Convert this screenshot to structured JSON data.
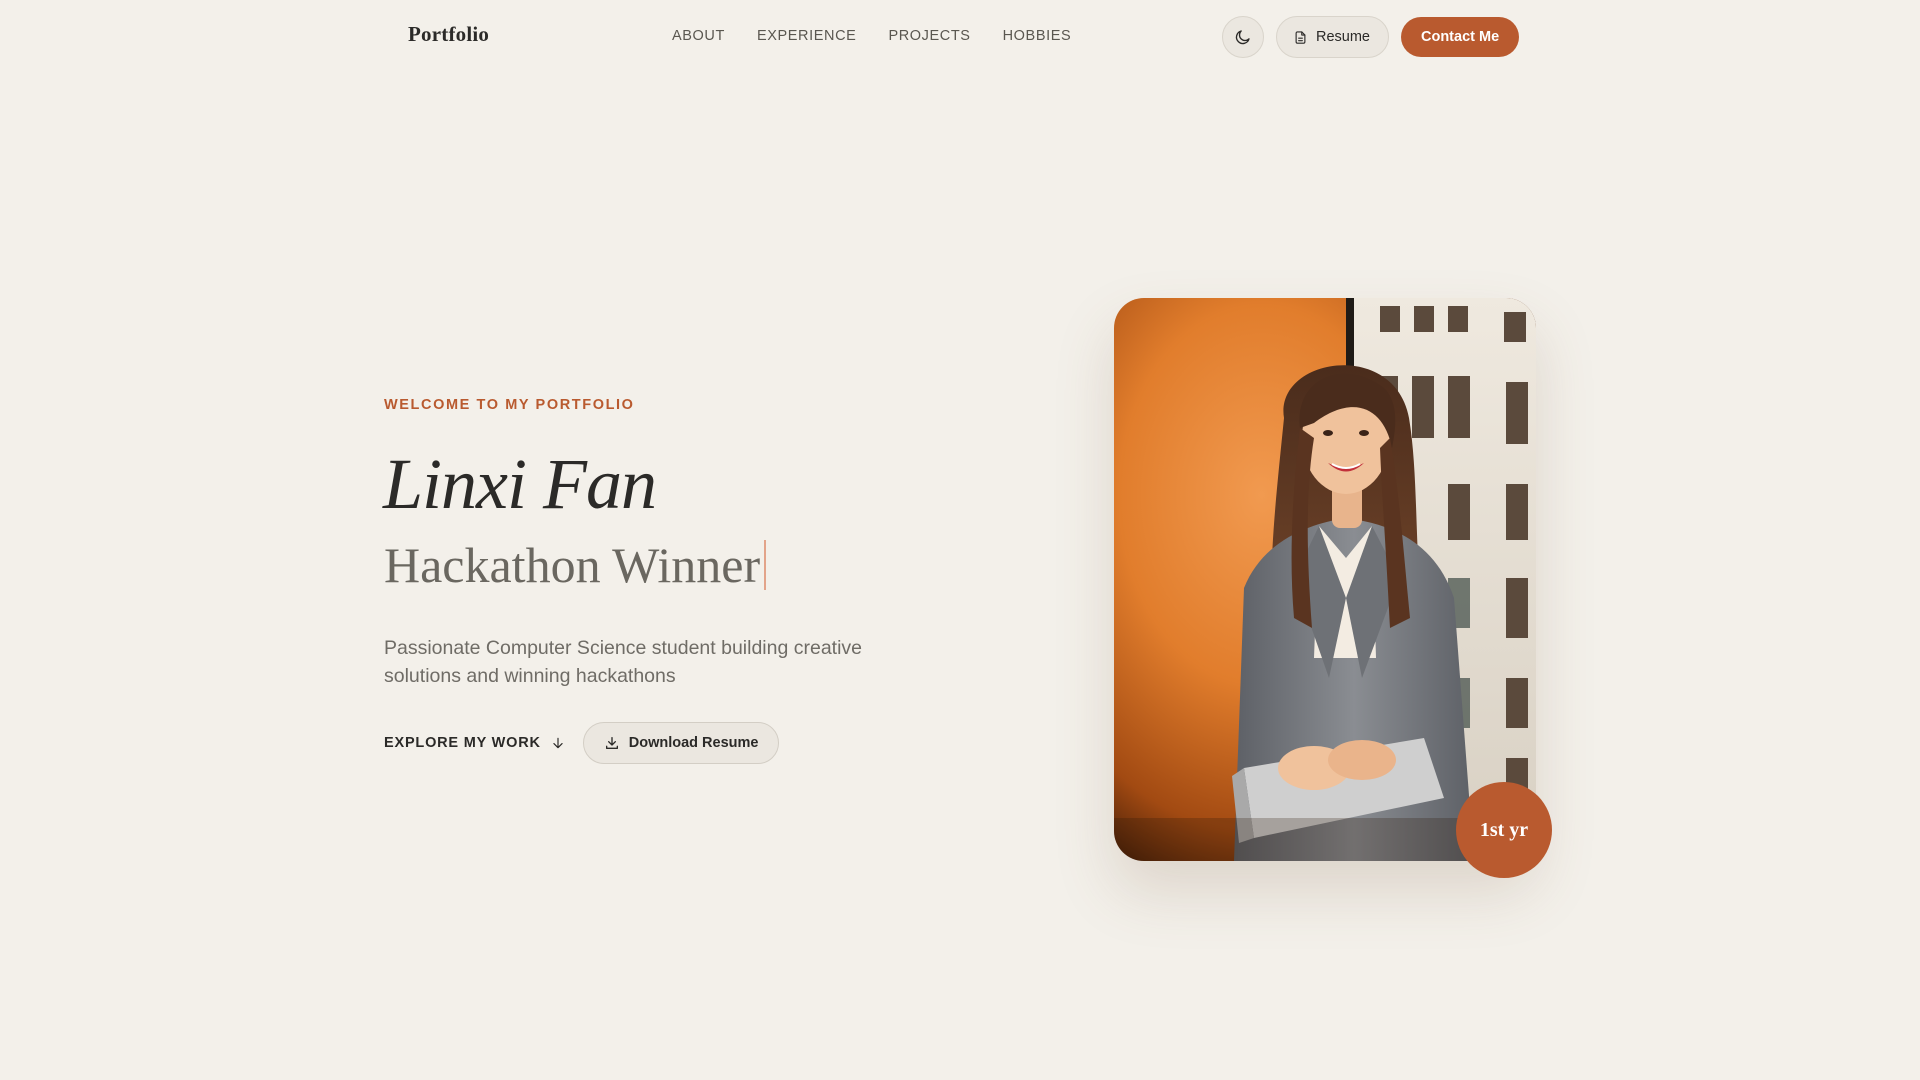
{
  "nav": {
    "logo": "Portfolio",
    "links": [
      "ABOUT",
      "EXPERIENCE",
      "PROJECTS",
      "HOBBIES"
    ],
    "resume_label": "Resume",
    "contact_label": "Contact Me",
    "theme_icon": "moon-icon"
  },
  "hero": {
    "eyebrow": "WELCOME TO MY PORTFOLIO",
    "name": "Linxi Fan",
    "role": "Hackathon Winner",
    "tagline": "Passionate Computer Science student building creative solutions and winning hackathons",
    "explore_label": "EXPLORE MY WORK",
    "download_label": "Download Resume"
  },
  "portrait": {
    "badge": "1st yr"
  },
  "colors": {
    "background": "#f3f0ea",
    "accent": "#b95a2f",
    "text": "#2b2a28",
    "muted": "#6f6c66"
  }
}
